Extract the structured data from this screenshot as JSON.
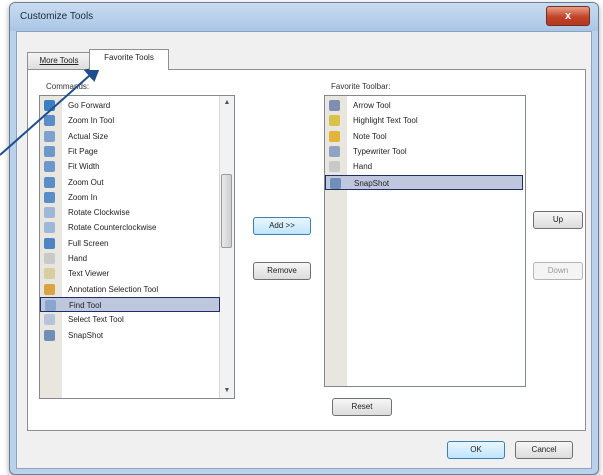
{
  "window": {
    "title": "Customize Tools",
    "close_label": "x"
  },
  "tabs": [
    {
      "label": "More Tools"
    },
    {
      "label": "Favorite Tools"
    }
  ],
  "commands": {
    "label": "Commands:",
    "items": [
      {
        "label": "Go Forward",
        "icon": "go-forward-icon",
        "color": "#3b7fc2"
      },
      {
        "label": "Zoom In Tool",
        "icon": "zoom-in-icon",
        "color": "#5a8ec9"
      },
      {
        "label": "Actual Size",
        "icon": "actual-size-icon",
        "color": "#7da2cf"
      },
      {
        "label": "Fit Page",
        "icon": "fit-page-icon",
        "color": "#6d98cc"
      },
      {
        "label": "Fit Width",
        "icon": "fit-width-icon",
        "color": "#6d98cc"
      },
      {
        "label": "Zoom Out",
        "icon": "zoom-out-icon",
        "color": "#5a8ec9"
      },
      {
        "label": "Zoom In",
        "icon": "zoom-in-icon",
        "color": "#5a8ec9"
      },
      {
        "label": "Rotate Clockwise",
        "icon": "rotate-cw-icon",
        "color": "#9db8d9"
      },
      {
        "label": "Rotate Counterclockwise",
        "icon": "rotate-ccw-icon",
        "color": "#9db8d9"
      },
      {
        "label": "Full Screen",
        "icon": "full-screen-icon",
        "color": "#4f84c4"
      },
      {
        "label": "Hand",
        "icon": "hand-icon",
        "color": "#c9c9c9"
      },
      {
        "label": "Text Viewer",
        "icon": "text-viewer-icon",
        "color": "#d8cfa0"
      },
      {
        "label": "Annotation Selection Tool",
        "icon": "annotation-select-icon",
        "color": "#d9a441"
      },
      {
        "label": "Find Tool",
        "icon": "find-icon",
        "color": "#8aa6cf"
      },
      {
        "label": "Select Text Tool",
        "icon": "select-text-icon",
        "color": "#b5c4da"
      },
      {
        "label": "SnapShot",
        "icon": "snapshot-icon",
        "color": "#6f8fb8"
      }
    ],
    "selected_index": 13
  },
  "favorites": {
    "label": "Favorite Toolbar:",
    "items": [
      {
        "label": "Arrow Tool",
        "icon": "arrow-tool-icon",
        "color": "#7c8fb0"
      },
      {
        "label": "Highlight Text Tool",
        "icon": "highlight-icon",
        "color": "#d8c24a"
      },
      {
        "label": "Note Tool",
        "icon": "note-icon",
        "color": "#e2b53a"
      },
      {
        "label": "Typewriter Tool",
        "icon": "typewriter-icon",
        "color": "#8fa4c4"
      },
      {
        "label": "Hand",
        "icon": "hand-icon",
        "color": "#c9c9c9"
      },
      {
        "label": "SnapShot",
        "icon": "snapshot-icon",
        "color": "#6f8fb8"
      }
    ],
    "selected_index": 5
  },
  "buttons": {
    "add": "Add >>",
    "remove": "Remove",
    "up": "Up",
    "down": "Down",
    "reset": "Reset",
    "ok": "OK",
    "cancel": "Cancel"
  },
  "colors": {
    "selection_fill": "#bfc7de",
    "selection_border": "#1f2f66",
    "annotation_arrow": "#1f4e8c"
  }
}
